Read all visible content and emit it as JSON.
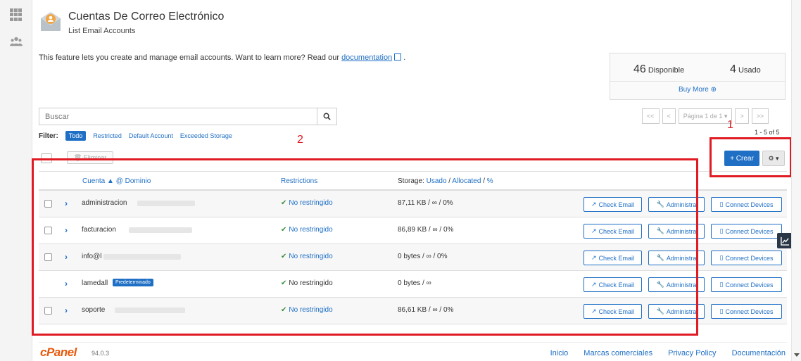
{
  "header": {
    "title": "Cuentas De Correo Electrónico",
    "subtitle": "List Email Accounts"
  },
  "intro": {
    "text": "This feature lets you create and manage email accounts. Want to learn more? Read our",
    "link": "documentation",
    "suffix": "."
  },
  "stats": {
    "available_count": "46",
    "available_label": "Disponible",
    "used_count": "4",
    "used_label": "Usado",
    "buy_more": "Buy More ⊕"
  },
  "search": {
    "placeholder": "Buscar"
  },
  "filter": {
    "label": "Filter:",
    "options": [
      "Todo",
      "Restricted",
      "Default Account",
      "Exceeded Storage"
    ]
  },
  "pager": {
    "first": "<<",
    "prev": "<",
    "page_label": "Página 1 de 1 ▾",
    "next": ">",
    "last": ">>",
    "count": "1 - 5 of 5"
  },
  "toolbar": {
    "delete_label": "🗑 Eliminar",
    "create_label": "+ Crear",
    "gear_label": "⚙ ▾"
  },
  "table": {
    "col_account": "Cuenta ▲ @ Dominio",
    "col_restrictions": "Restrictions",
    "col_storage_prefix": "Storage:",
    "col_storage_used": "Usado",
    "col_storage_alloc": "Allocated",
    "col_storage_pct": "%",
    "sep": "/",
    "rows": [
      {
        "account": "administracion",
        "restriction": "No restringido",
        "storage": "87,11 KB / ∞ / 0%"
      },
      {
        "account": "facturacion",
        "restriction": "No restringido",
        "storage": "86,89 KB / ∞ / 0%"
      },
      {
        "account": "info@l",
        "restriction": "No restringido",
        "storage": "0 bytes / ∞ / 0%"
      },
      {
        "account": "lamedall",
        "badge": "Predeterminado",
        "restriction": "No restringido",
        "storage": "0 bytes / ∞"
      },
      {
        "account": "soporte",
        "restriction": "No restringido",
        "storage": "86,61 KB / ∞ / 0%"
      }
    ],
    "actions": {
      "check_email": "Check Email",
      "manage": "Administra",
      "connect": "Connect Devices"
    }
  },
  "annotations": {
    "one": "1",
    "two": "2"
  },
  "footer": {
    "logo": "cPanel",
    "version": "94.0.3",
    "links": [
      "Inicio",
      "Marcas comerciales",
      "Privacy Policy",
      "Documentación"
    ]
  },
  "colors": {
    "accent": "#1f6fc5",
    "annotation": "#e01b24",
    "ok": "#3c8d3c",
    "brand": "#e8590c"
  }
}
